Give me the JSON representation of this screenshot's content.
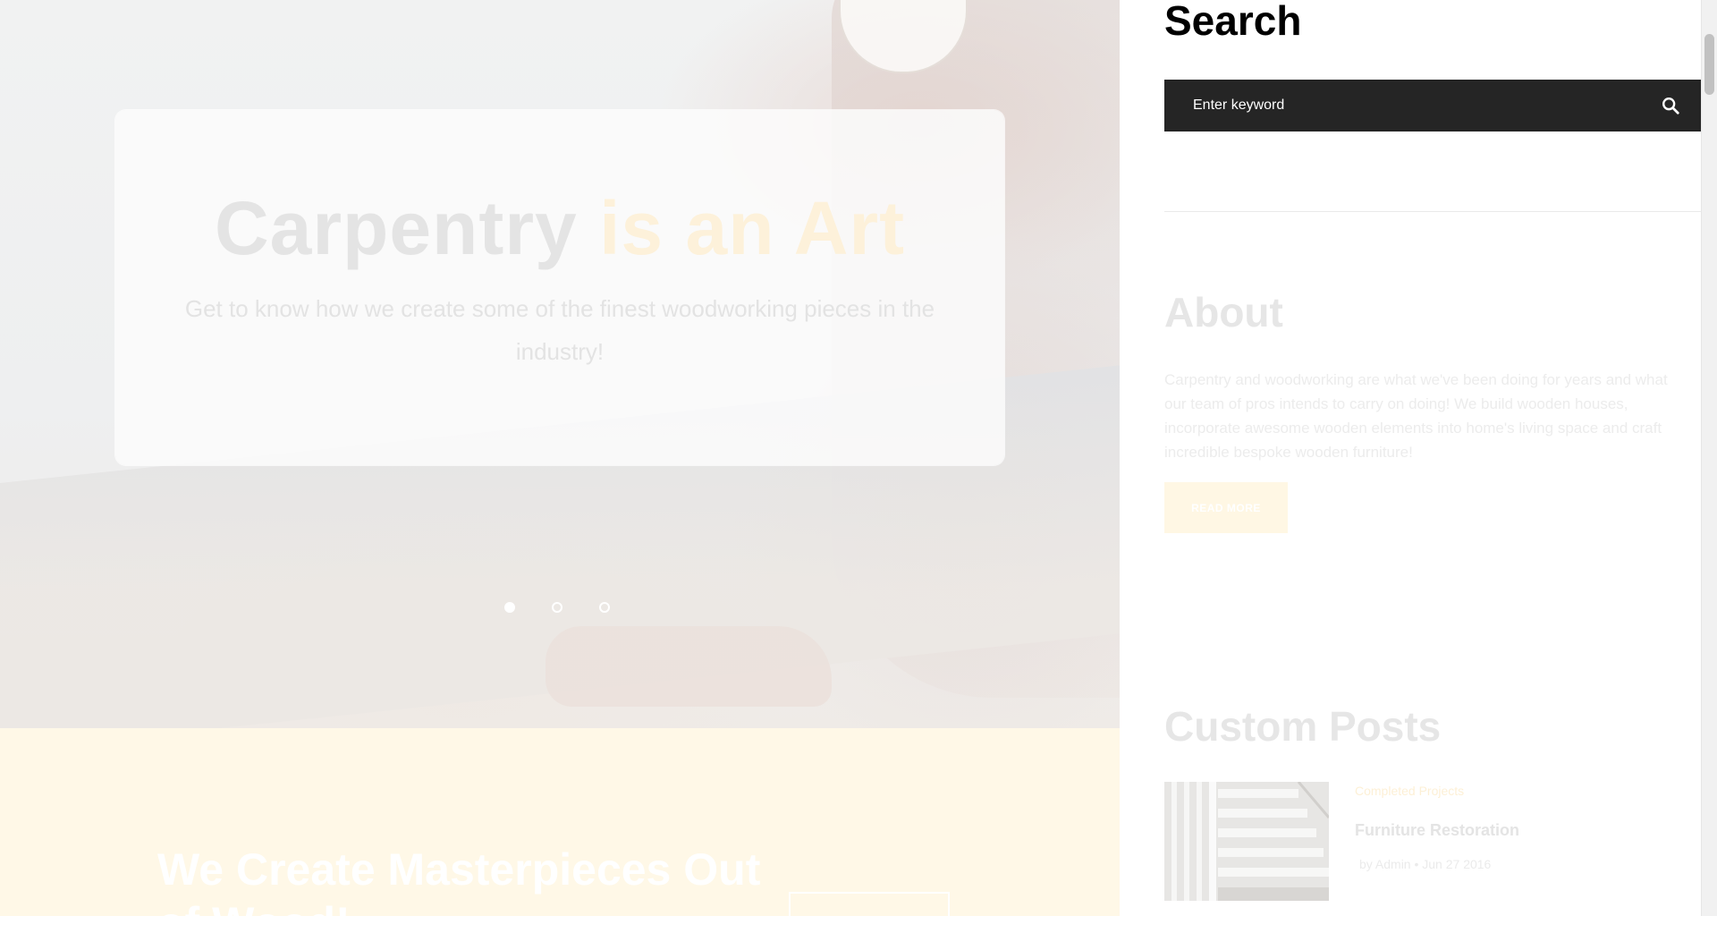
{
  "hero": {
    "title_part1": "Carpentry",
    "title_part2": "is an Art",
    "subtitle": "Get to know how we create some of the finest woodworking pieces in the industry!",
    "slides": 3,
    "active_slide": 1
  },
  "band": {
    "title": "We Create Masterpieces Out of Wood!"
  },
  "sidebar": {
    "search": {
      "heading": "Search",
      "placeholder": "Enter keyword",
      "icon": "search-icon"
    },
    "about": {
      "heading": "About",
      "text": "Carpentry and woodworking are what we've been doing for years and what our team of pros intends to carry on doing! We build wooden houses, incorporate awesome wooden elements into home's living space and craft incredible bespoke wooden furniture!",
      "button_label": "READ MORE"
    },
    "custom_posts": {
      "heading": "Custom Posts",
      "posts": [
        {
          "category": "Completed Projects",
          "title": "Furniture Restoration",
          "meta": "by Admin  •  Jun 27 2016"
        }
      ]
    }
  },
  "colors": {
    "accent": "#fdf1da",
    "search_bg": "#252525",
    "band_bg": "#fff8e7"
  }
}
